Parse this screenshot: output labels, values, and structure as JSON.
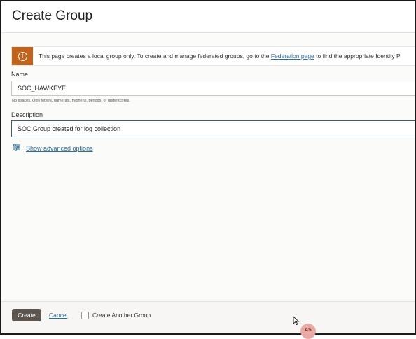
{
  "page": {
    "title": "Create Group"
  },
  "banner": {
    "text_before": "This page creates a local group only. To create and manage federated groups, go to the ",
    "link_text": "Federation page",
    "text_after": " to find the appropriate Identity P"
  },
  "name_field": {
    "label": "Name",
    "value": "SOC_HAWKEYE",
    "hint": "No spaces. Only letters, numerals, hyphens, periods, or underscores."
  },
  "description_field": {
    "label": "Description",
    "value": "SOC Group created for log collection"
  },
  "advanced": {
    "label": "Show advanced options"
  },
  "footer": {
    "create_label": "Create",
    "cancel_label": "Cancel",
    "create_another_label": "Create Another Group",
    "create_another_checked": false
  },
  "user": {
    "initials": "AS"
  },
  "colors": {
    "banner_accent": "#c1631b",
    "link": "#2a6e9c",
    "primary_button": "#5d5650",
    "avatar_bg": "#e9a9a4"
  },
  "icons": {
    "banner": "warning-icon",
    "advanced": "sliders-icon",
    "cursor": "mouse-cursor-icon"
  }
}
